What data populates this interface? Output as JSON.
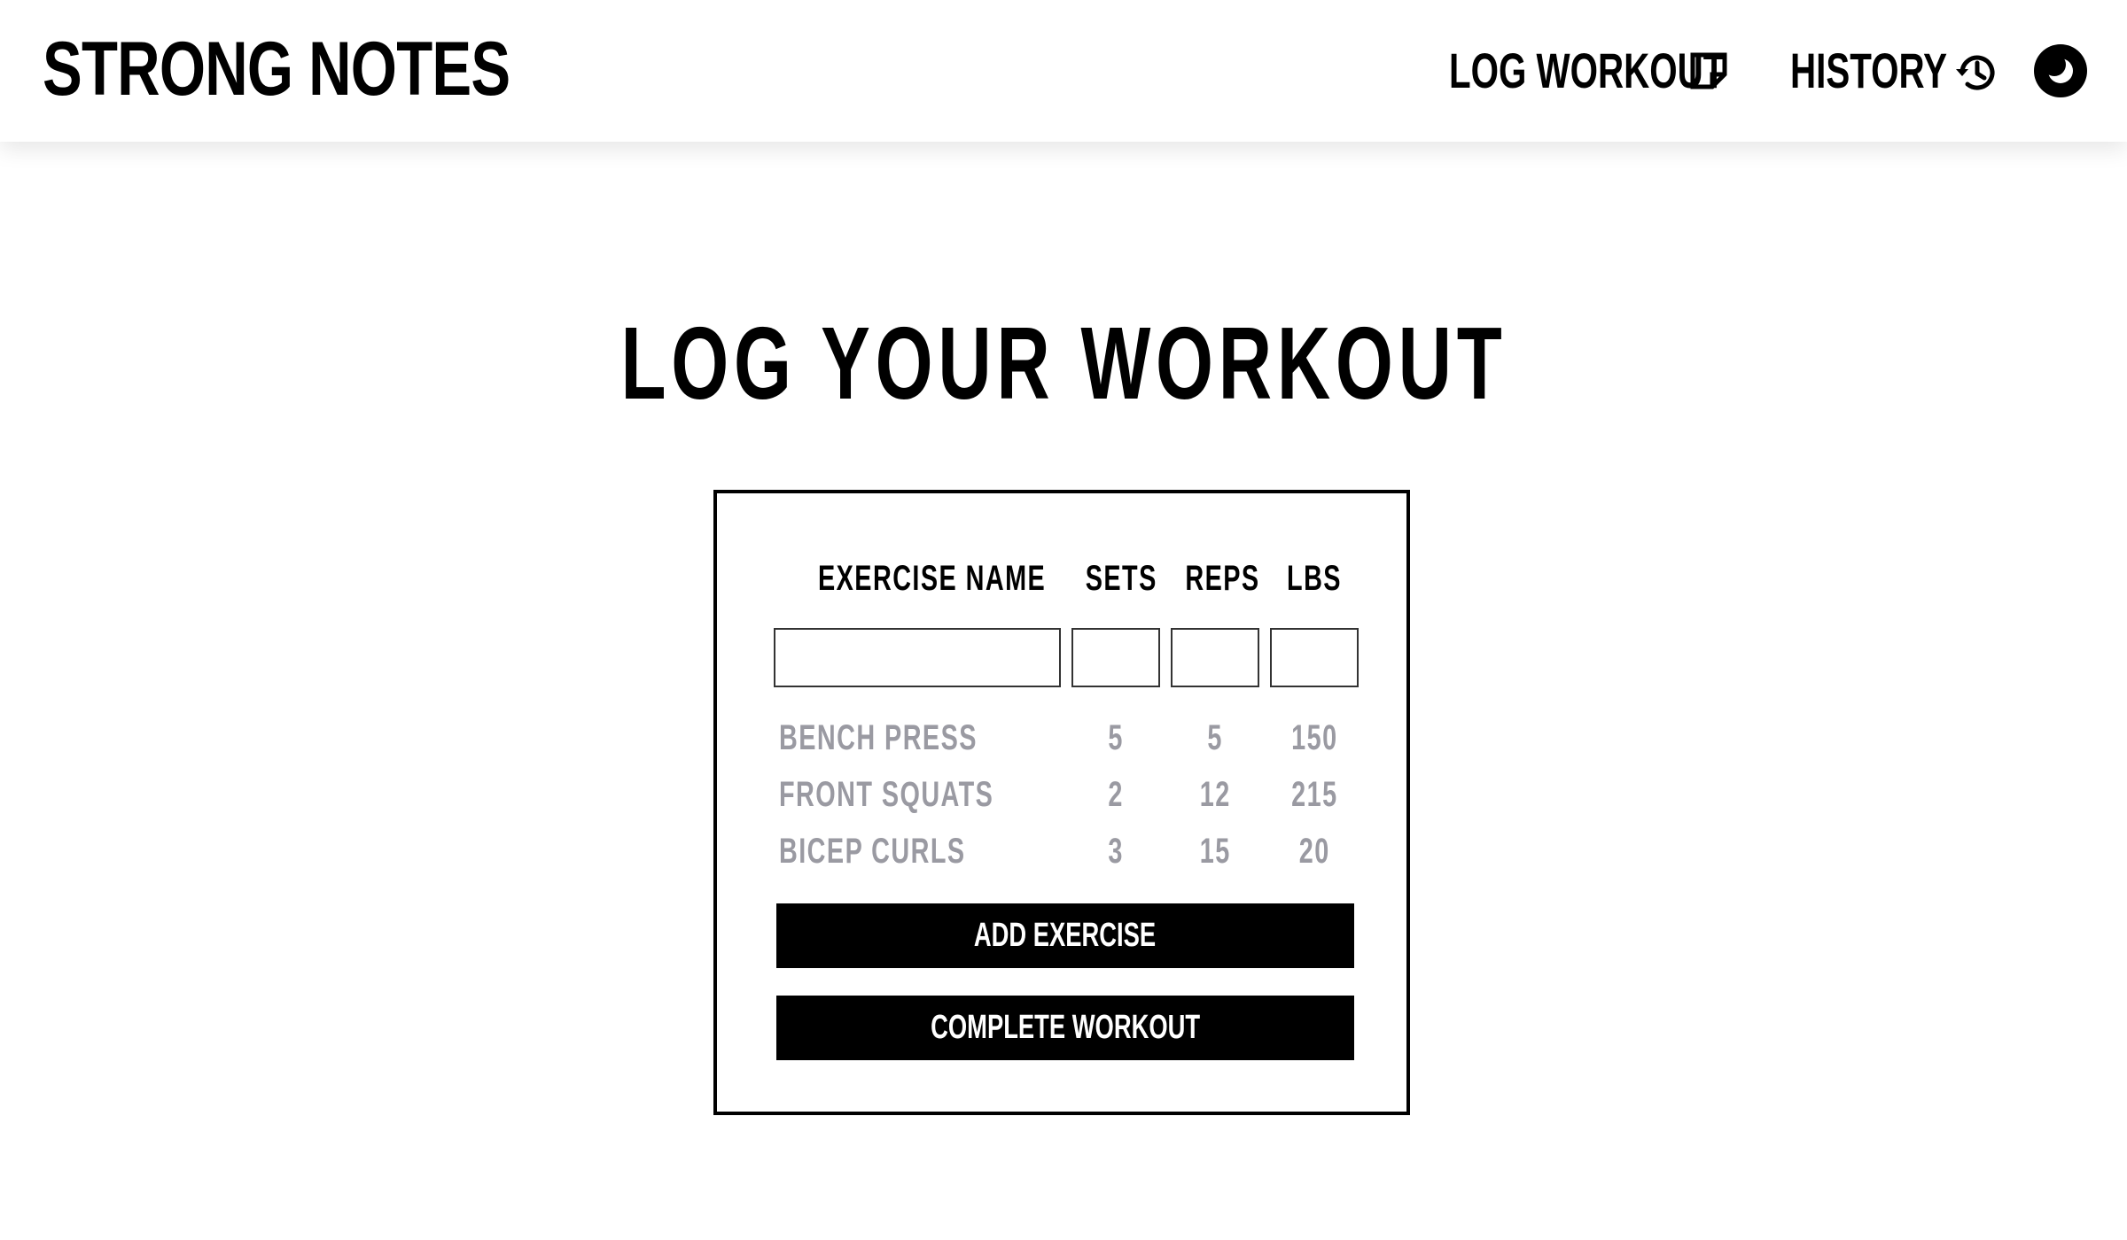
{
  "header": {
    "brand": "STRONG NOTES",
    "nav": {
      "log_workout": "LOG WORKOUT",
      "history": "HISTORY"
    },
    "icons": {
      "log_workout": "note-icon",
      "history": "history-icon",
      "theme_toggle": "moon-icon"
    }
  },
  "main": {
    "title": "LOG YOUR WORKOUT",
    "table": {
      "columns": [
        "EXERCISE NAME",
        "SETS",
        "REPS",
        "LBS"
      ],
      "inputs": {
        "exercise_name": "",
        "sets": "",
        "reps": "",
        "lbs": ""
      },
      "rows": [
        {
          "name": "BENCH PRESS",
          "sets": "5",
          "reps": "5",
          "lbs": "150"
        },
        {
          "name": "FRONT SQUATS",
          "sets": "2",
          "reps": "12",
          "lbs": "215"
        },
        {
          "name": "BICEP CURLS",
          "sets": "3",
          "reps": "15",
          "lbs": "20"
        }
      ]
    },
    "buttons": {
      "add_exercise": "ADD EXERCISE",
      "complete_workout": "COMPLETE WORKOUT"
    }
  },
  "colors": {
    "accent": "#000000",
    "background": "#ffffff",
    "muted_text": "#9a9aa2"
  }
}
